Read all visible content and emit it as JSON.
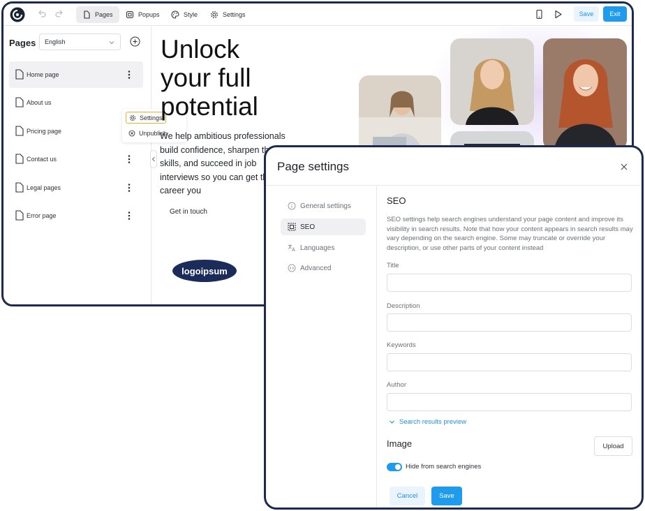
{
  "topbar": {
    "tabs": [
      {
        "label": "Pages",
        "icon": "page-icon"
      },
      {
        "label": "Popups",
        "icon": "popup-icon"
      },
      {
        "label": "Style",
        "icon": "palette-icon"
      },
      {
        "label": "Settings",
        "icon": "gear-icon"
      }
    ],
    "save_label": "Save",
    "exit_label": "Exit"
  },
  "sidebar": {
    "title": "Pages",
    "language": "English",
    "pages": [
      {
        "label": "Home page"
      },
      {
        "label": "About us"
      },
      {
        "label": "Pricing page"
      },
      {
        "label": "Contact us"
      },
      {
        "label": "Legal pages"
      },
      {
        "label": "Error page"
      }
    ],
    "context_menu": {
      "settings": "Settings",
      "unpublish": "Unpublish"
    }
  },
  "canvas": {
    "headline": "Unlock your full potential",
    "subtext": "We help ambitious professionals build confidence, sharpen their skills, and succeed in job interviews so you can get the career you",
    "cta": "Get in touch",
    "logo_text": "logoipsum"
  },
  "modal": {
    "title": "Page settings",
    "nav": [
      {
        "label": "General settings",
        "icon": "info-icon"
      },
      {
        "label": "SEO",
        "icon": "seo-icon"
      },
      {
        "label": "Languages",
        "icon": "translate-icon"
      },
      {
        "label": "Advanced",
        "icon": "code-icon"
      }
    ],
    "seo_heading": "SEO",
    "seo_description": "SEO settings help search engines understand your page content and improve its visibility in search results. Note that how your content appears in search results may vary depending on the search engine. Some may truncate or override your description, or use other parts of your content instead",
    "fields": {
      "title": "Title",
      "description": "Description",
      "keywords": "Keywords",
      "author": "Author"
    },
    "preview_link": "Search results preview",
    "image_heading": "Image",
    "upload_label": "Upload",
    "hide_toggle_label": "Hide from search engines",
    "hide_toggle_on": true,
    "cancel_label": "Cancel",
    "save_label": "Save"
  },
  "colors": {
    "accent": "#1f9bee",
    "frame": "#1c2a52",
    "logo_bg": "#1b2b5a"
  }
}
